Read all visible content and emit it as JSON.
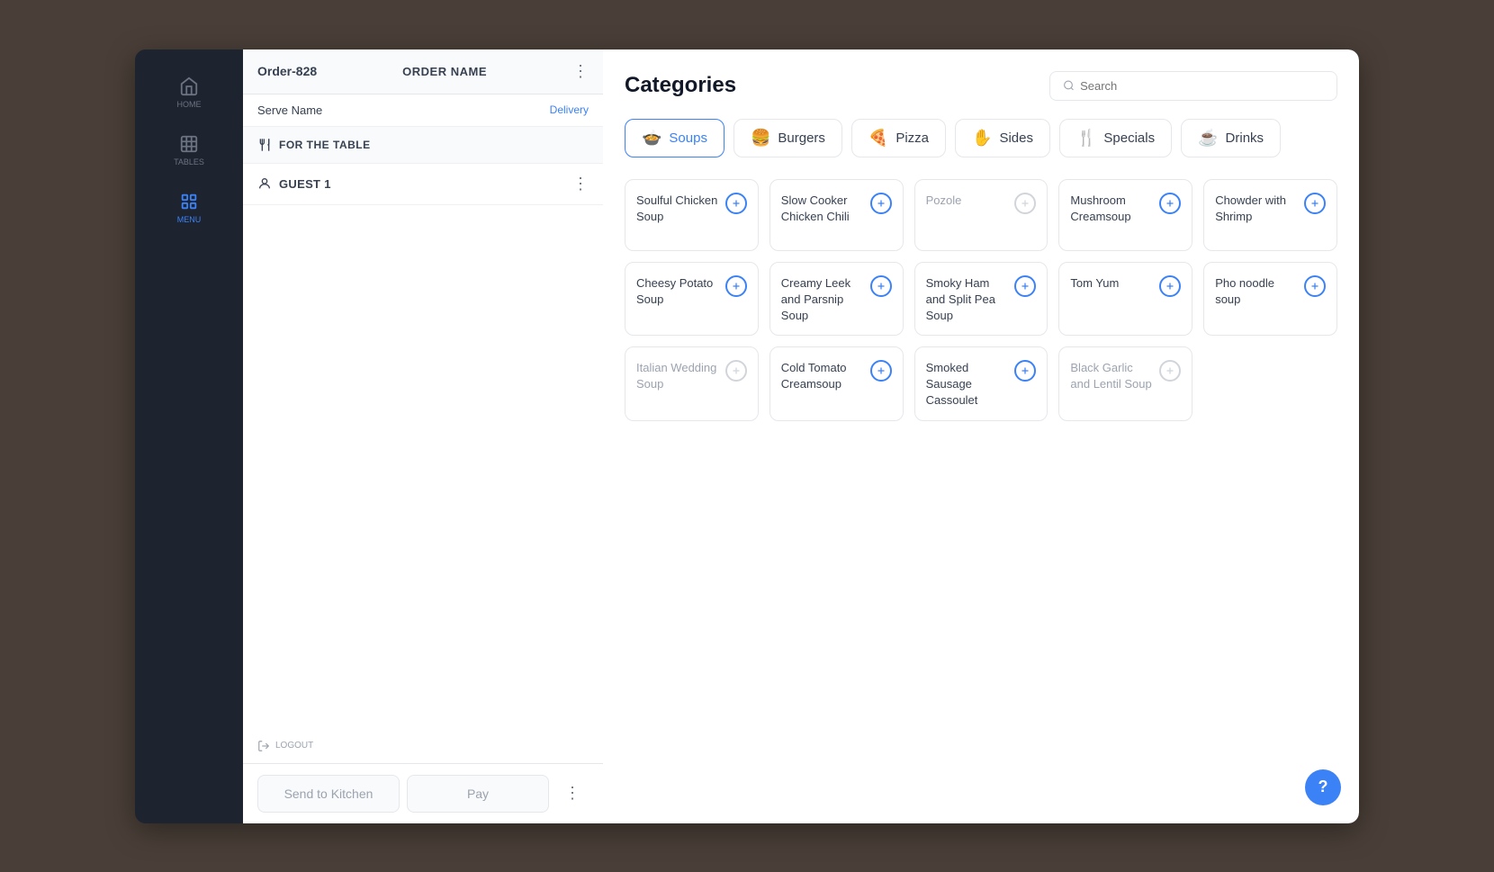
{
  "sidebar": {
    "items": [
      {
        "id": "home",
        "label": "HOME",
        "active": false
      },
      {
        "id": "tables",
        "label": "TABLES",
        "active": false
      },
      {
        "id": "menu",
        "label": "MENU",
        "active": true
      }
    ]
  },
  "order": {
    "id": "Order-828",
    "name_label": "ORDER NAME",
    "serve_label": "Serve Name",
    "delivery": "Delivery",
    "for_table": "FOR THE TABLE",
    "guest": "GUEST 1",
    "send_kitchen_label": "Send to Kitchen",
    "pay_label": "Pay",
    "logout_label": "LOGOUT"
  },
  "menu": {
    "title": "Categories",
    "search_placeholder": "Search",
    "categories": [
      {
        "id": "soups",
        "label": "Soups",
        "active": true,
        "icon": "🍲"
      },
      {
        "id": "burgers",
        "label": "Burgers",
        "active": false,
        "icon": "🍔"
      },
      {
        "id": "pizza",
        "label": "Pizza",
        "active": false,
        "icon": "🍕"
      },
      {
        "id": "sides",
        "label": "Sides",
        "active": false,
        "icon": "✋"
      },
      {
        "id": "specials",
        "label": "Specials",
        "active": false,
        "icon": "🍴"
      },
      {
        "id": "drinks",
        "label": "Drinks",
        "active": false,
        "icon": "☕"
      }
    ],
    "items": [
      {
        "id": 1,
        "name": "Soulful Chicken Soup",
        "grayed": false
      },
      {
        "id": 2,
        "name": "Slow Cooker Chicken Chili",
        "grayed": false
      },
      {
        "id": 3,
        "name": "Pozole",
        "grayed": true
      },
      {
        "id": 4,
        "name": "Mushroom Creamsoup",
        "grayed": false
      },
      {
        "id": 5,
        "name": "Chowder with Shrimp",
        "grayed": false
      },
      {
        "id": 6,
        "name": "Cheesy Potato Soup",
        "grayed": false
      },
      {
        "id": 7,
        "name": "Creamy Leek and Parsnip Soup",
        "grayed": false
      },
      {
        "id": 8,
        "name": "Smoky Ham and Split Pea Soup",
        "grayed": false
      },
      {
        "id": 9,
        "name": "Tom Yum",
        "grayed": false
      },
      {
        "id": 10,
        "name": "Pho noodle soup",
        "grayed": false
      },
      {
        "id": 11,
        "name": "Italian Wedding Soup",
        "grayed": true
      },
      {
        "id": 12,
        "name": "Cold Tomato Creamsoup",
        "grayed": false
      },
      {
        "id": 13,
        "name": "Smoked Sausage Cassoulet",
        "grayed": false
      },
      {
        "id": 14,
        "name": "Black Garlic and Lentil Soup",
        "grayed": true
      }
    ]
  }
}
